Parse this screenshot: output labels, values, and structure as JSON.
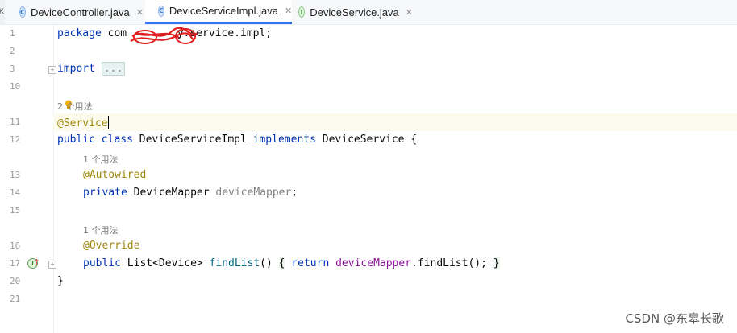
{
  "tabs": [
    {
      "label": "DeviceController.java",
      "icon": "class-icon",
      "icon_letter": "C"
    },
    {
      "label": "DeviceServiceImpl.java",
      "icon": "class-icon",
      "icon_letter": "C",
      "active": true
    },
    {
      "label": "DeviceService.java",
      "icon": "interface-icon",
      "icon_letter": "I"
    }
  ],
  "tab_close": "✕",
  "left_strip_text": "K",
  "line_numbers": [
    "1",
    "2",
    "3",
    "10",
    "",
    "11",
    "12",
    "",
    "13",
    "14",
    "15",
    "",
    "16",
    "17",
    "20",
    "21"
  ],
  "code": {
    "package_kw": "package",
    "package_name": "com",
    "package_tail": "y.service.impl;",
    "import_kw": "import",
    "import_fold": "...",
    "hint_class": "2 个用法",
    "annotation_service": "@Service",
    "public_kw": "public",
    "class_kw": "class",
    "class_name": "DeviceServiceImpl",
    "implements_kw": "implements",
    "iface_name": "DeviceService",
    "open_brace": "{",
    "hint_field": "1 个用法",
    "annotation_autowired": "@Autowired",
    "private_kw": "private",
    "field_type": "DeviceMapper",
    "field_name": "deviceMapper",
    "semicolon": ";",
    "hint_method": "1 个用法",
    "annotation_override": "@Override",
    "method_public": "public",
    "method_return_type": "List<Device>",
    "method_name": "findList",
    "method_parens": "()",
    "method_body_open": "{",
    "return_kw": "return",
    "return_field": "deviceMapper",
    "return_call": ".findList();",
    "method_body_close": "}",
    "close_brace": "}"
  },
  "watermark": "CSDN @东皋长歌",
  "colors": {
    "keyword": "#0033b3",
    "annotation": "#9e880d",
    "field": "#871094",
    "method": "#00627a",
    "active_tab": "#3574f0"
  }
}
